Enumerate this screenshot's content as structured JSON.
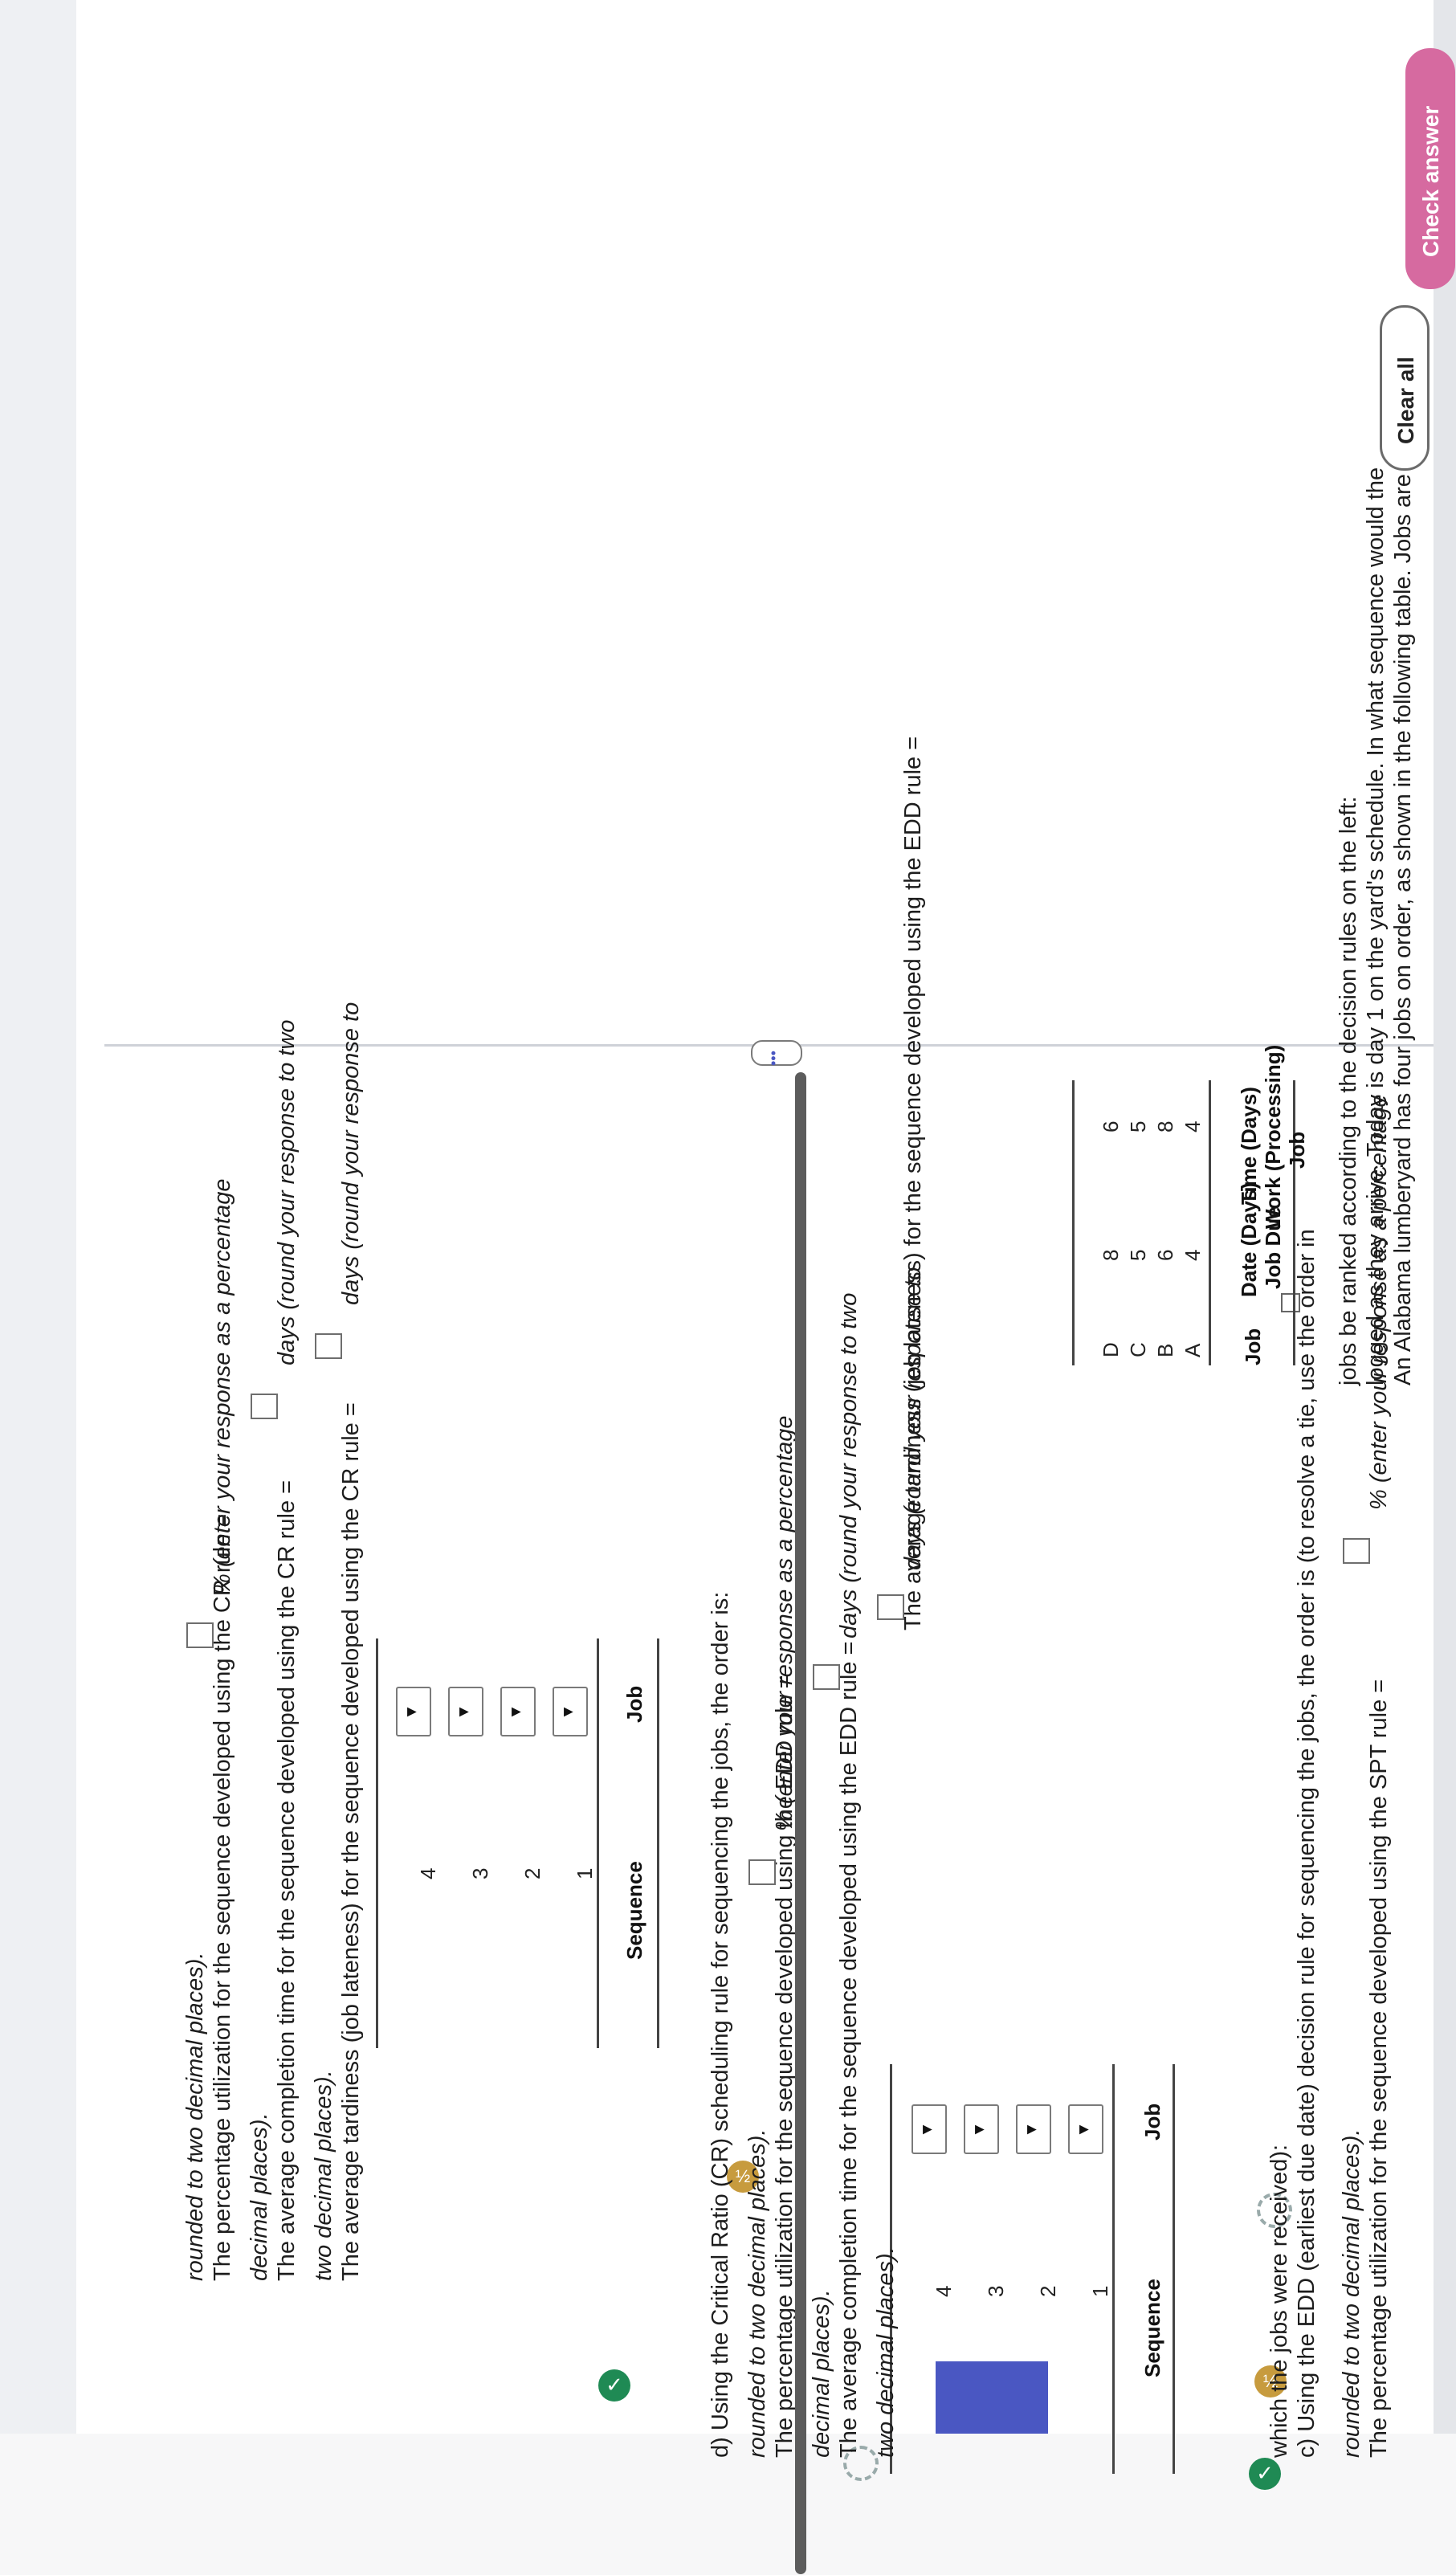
{
  "spt": {
    "pct_pre": "The percentage utilization for the sequence developed using the SPT rule =",
    "pct_post": "% (enter your response as a percentage",
    "pct_post2": "rounded to two decimal places)."
  },
  "c": {
    "q1": "c) Using the EDD (earliest due date) decision rule for sequencing the jobs, the order is (to resolve a tie, use the order in",
    "q2": "which the jobs were received):",
    "seq_header": "Sequence",
    "job_header": "Job",
    "sequence": [
      "1",
      "2",
      "3",
      "4"
    ],
    "tard_pre": "The average tardiness (job lateness) for the sequence developed using the EDD rule =",
    "tard_post": "days (round your response to",
    "tard_post2": "two decimal places).",
    "comp_pre": "The average completion time for the sequence developed using the EDD rule =",
    "comp_post": "days (round your response to two",
    "comp_post2": "decimal places).",
    "pct_pre": "The percentage utilization for the sequence developed using the EDD rule =",
    "pct_post": "% (enter your response as a percentage",
    "pct_post2": "rounded to two decimal places)."
  },
  "d": {
    "q": "d) Using the Critical Ratio (CR) scheduling rule for sequencing the jobs, the order is:",
    "seq_header": "Sequence",
    "job_header": "Job",
    "sequence": [
      "1",
      "2",
      "3",
      "4"
    ],
    "tard_pre": "The average tardiness (job lateness) for the sequence developed using the CR rule =",
    "tard_post": "days (round your response to",
    "tard_post2": "two decimal places).",
    "comp_pre": "The average completion time for the sequence developed using the CR rule =",
    "comp_post": "days (round your response to two",
    "comp_post2": "decimal places).",
    "pct_pre": "The percentage utilization for the sequence developed using the CR rule =",
    "pct_post": "% (enter your response as a percentage",
    "pct_post2": "rounded to two decimal places)."
  },
  "problem": {
    "line1": "An Alabama lumberyard has four jobs on order, as shown in the following table. Jobs are",
    "line2": "logged as they arrive. Today is day 1 on the yard's schedule. In what sequence would the",
    "line3": "jobs be ranked according to the decision rules on the left:",
    "table": {
      "col_job": "Job",
      "col_due_1": "Job Due",
      "col_due_2": "Date (Days)",
      "col_work_1": "Job",
      "col_work_2": "Work (Processing)",
      "col_work_3": "Time (Days)",
      "rows": [
        {
          "job": "A",
          "due": "4",
          "work": "4"
        },
        {
          "job": "B",
          "due": "6",
          "work": "8"
        },
        {
          "job": "C",
          "due": "5",
          "work": "5"
        },
        {
          "job": "D",
          "due": "8",
          "work": "6"
        }
      ]
    }
  },
  "dropdown_glyph": "▼",
  "more_glyph": "•••",
  "partial_glyph": "½",
  "check_glyph": "✓",
  "buttons": {
    "clear_all": "Clear all",
    "check_answer": "Check answer"
  },
  "colors": {
    "check_green": "#1f8a54",
    "partial_gold": "#c79b3e",
    "active_blue": "#4a57c2",
    "button_pink": "#d66aa0"
  }
}
